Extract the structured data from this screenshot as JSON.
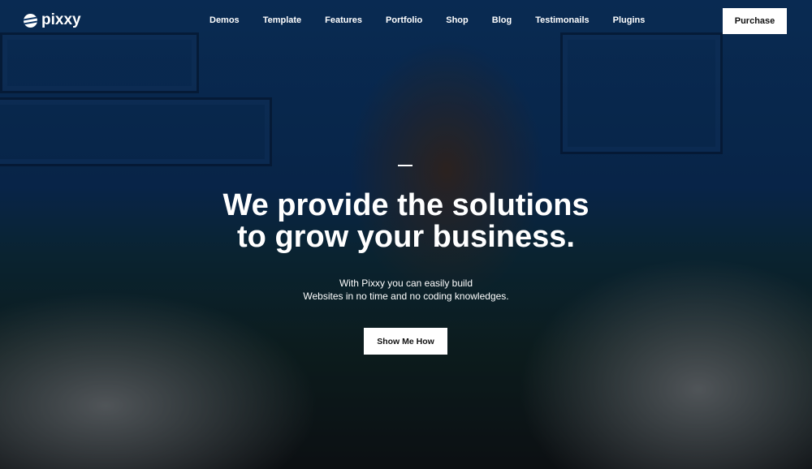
{
  "brand": {
    "name": "pixxy"
  },
  "nav": {
    "items": [
      "Demos",
      "Template",
      "Features",
      "Portfolio",
      "Shop",
      "Blog",
      "Testimonails",
      "Plugins"
    ]
  },
  "header": {
    "purchase_label": "Purchase"
  },
  "hero": {
    "title_line1": "We provide the solutions",
    "title_line2": "to grow your business.",
    "subtitle_line1": "With Pixxy you can easily build",
    "subtitle_line2": "Websites in no time and no coding knowledges.",
    "cta_label": "Show Me How"
  }
}
